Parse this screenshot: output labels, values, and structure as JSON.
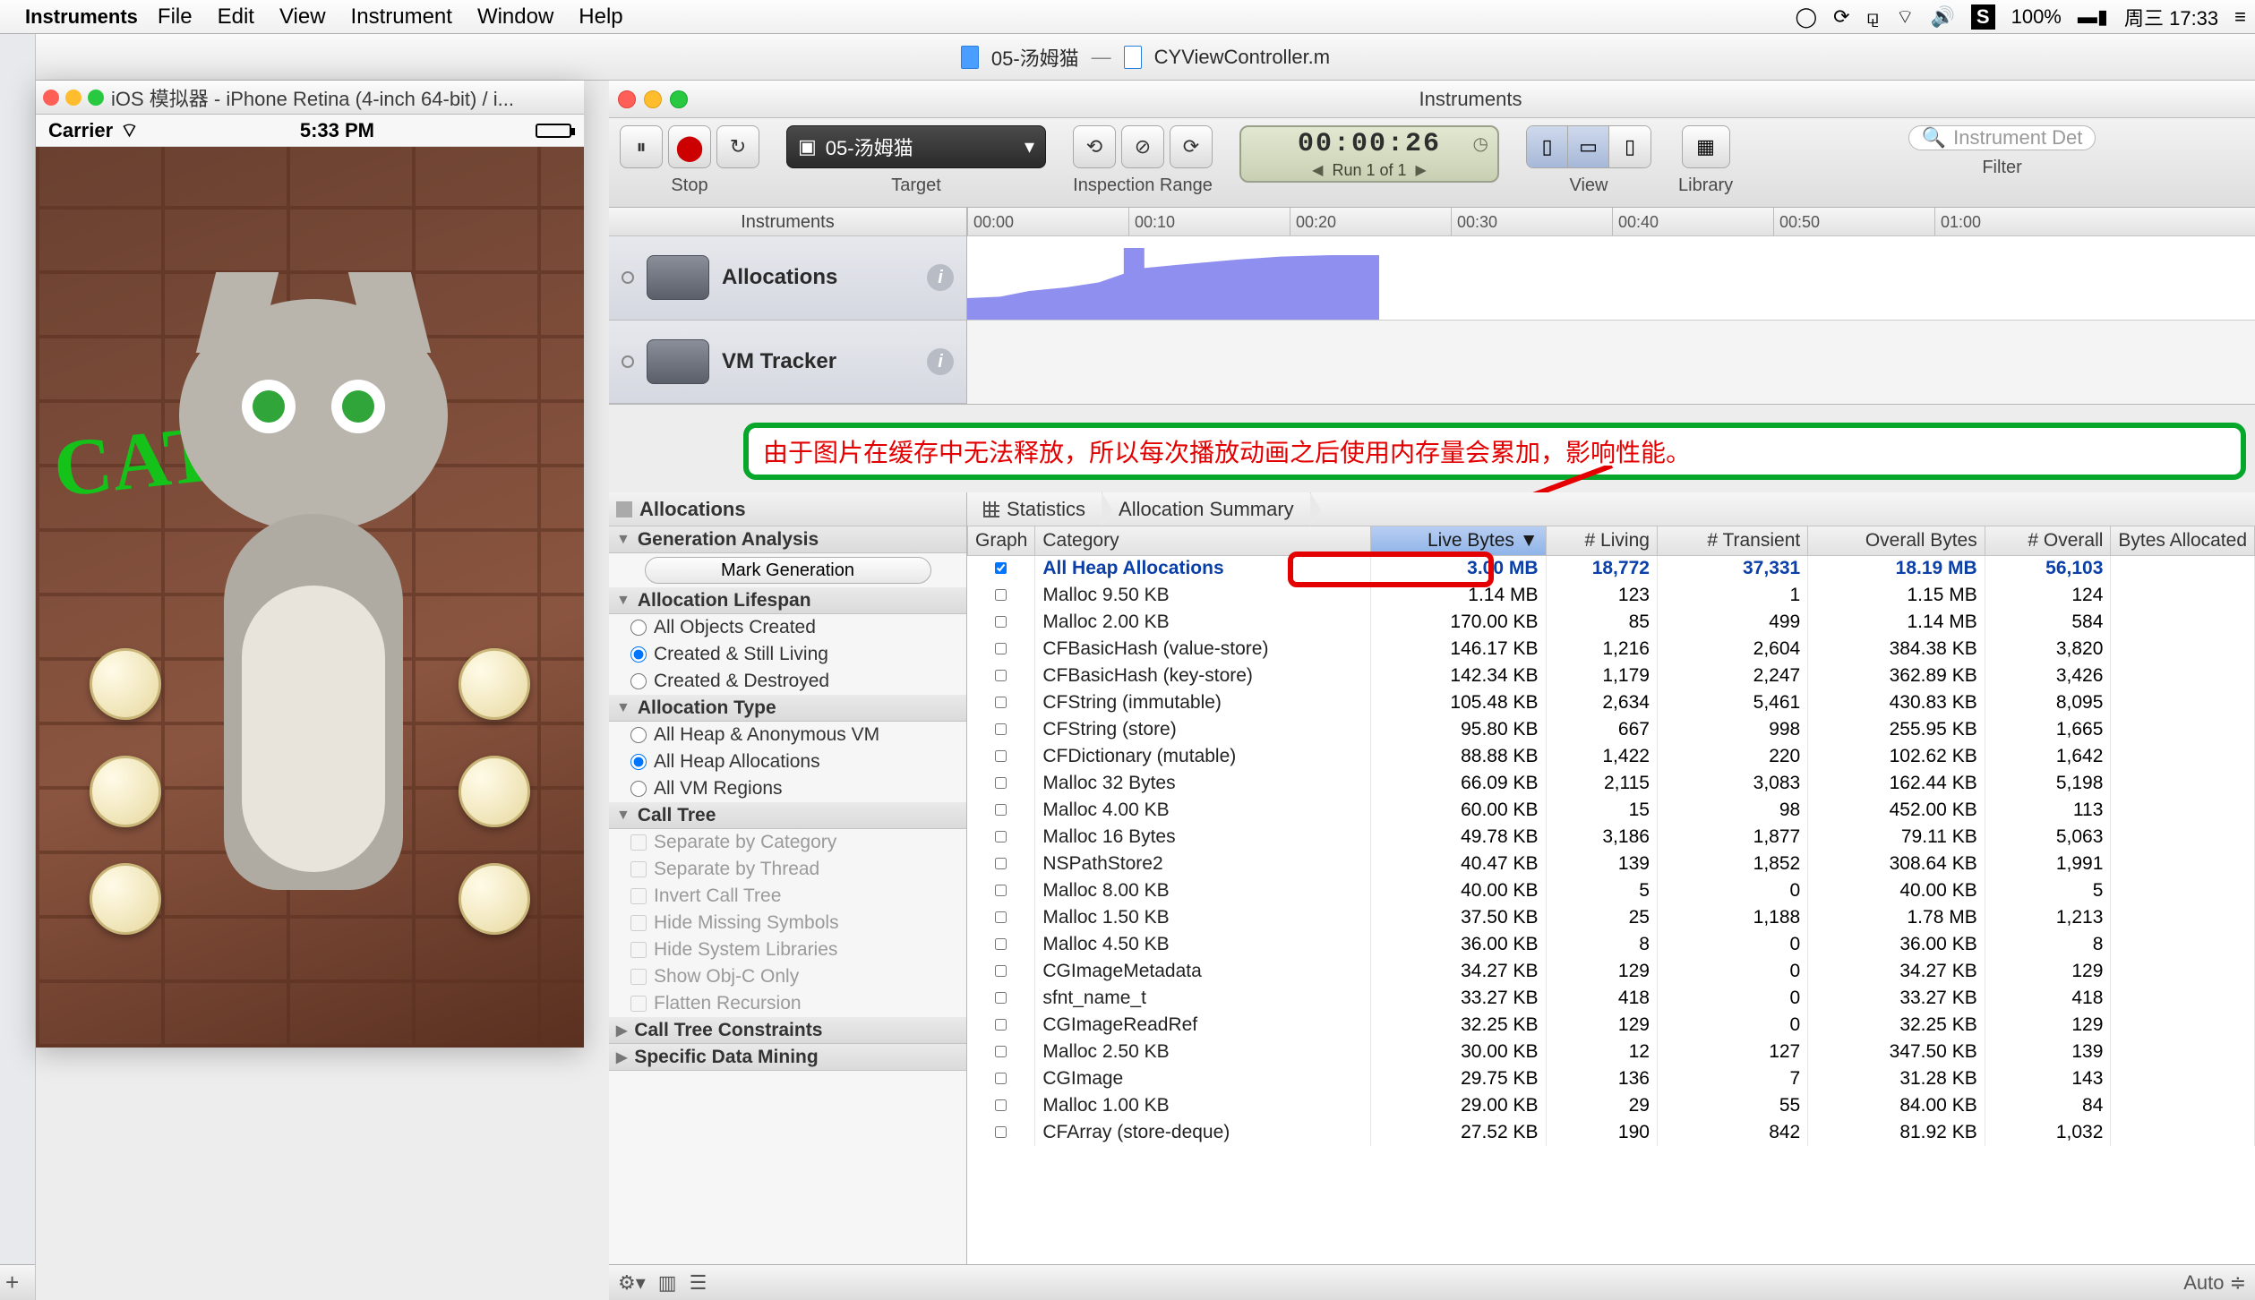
{
  "menubar": {
    "app": "Instruments",
    "items": [
      "File",
      "Edit",
      "View",
      "Instrument",
      "Window",
      "Help"
    ],
    "battery": "100%",
    "clock": "周三 17:33",
    "s_icon": "S"
  },
  "xcode": {
    "doc1": "05-汤姆猫",
    "sep": "—",
    "doc2": "CYViewController.m"
  },
  "simulator": {
    "title": "iOS 模拟器 - iPhone Retina (4-inch 64-bit) / i...",
    "carrier": "Carrier",
    "time": "5:33 PM",
    "graffiti": "CAT"
  },
  "instruments": {
    "window_title": "Instruments",
    "stop_label": "Stop",
    "target_label": "Target",
    "target_value": "05-汤姆猫",
    "inspection_label": "Inspection Range",
    "timer": "00:00:26",
    "run_text": "Run 1 of 1",
    "view_label": "View",
    "library_label": "Library",
    "filter_label": "Filter",
    "search_placeholder": "Instrument Det",
    "tracks_header": "Instruments",
    "track1": "Allocations",
    "track2": "VM Tracker",
    "ruler": [
      "00:00",
      "00:10",
      "00:20",
      "00:30",
      "00:40",
      "00:50",
      "01:00"
    ]
  },
  "annotation": "由于图片在缓存中无法释放，所以每次播放动画之后使用内存量会累加，影响性能。",
  "sidebar": {
    "header": "Allocations",
    "sections": {
      "gen": "Generation Analysis",
      "mark": "Mark Generation",
      "lifespan": "Allocation Lifespan",
      "ls_items": [
        "All Objects Created",
        "Created & Still Living",
        "Created & Destroyed"
      ],
      "alloc_type": "Allocation Type",
      "at_items": [
        "All Heap & Anonymous VM",
        "All Heap Allocations",
        "All VM Regions"
      ],
      "call_tree": "Call Tree",
      "ct_items": [
        "Separate by Category",
        "Separate by Thread",
        "Invert Call Tree",
        "Hide Missing Symbols",
        "Hide System Libraries",
        "Show Obj-C Only",
        "Flatten Recursion"
      ],
      "constraints": "Call Tree Constraints",
      "mining": "Specific Data Mining"
    }
  },
  "breadcrumb": {
    "stats": "Statistics",
    "summary": "Allocation Summary"
  },
  "table": {
    "headers": {
      "graph": "Graph",
      "category": "Category",
      "live_bytes": "Live Bytes",
      "living": "# Living",
      "transient": "# Transient",
      "overall_bytes": "Overall Bytes",
      "overall": "# Overall",
      "bytes_alloc": "Bytes Allocated"
    },
    "rows": [
      {
        "cat": "All Heap Allocations",
        "lb": "3.00 MB",
        "liv": "18,772",
        "tr": "37,331",
        "ob": "18.19 MB",
        "ov": "56,103",
        "sel": true,
        "chk": true
      },
      {
        "cat": "Malloc 9.50 KB",
        "lb": "1.14 MB",
        "liv": "123",
        "tr": "1",
        "ob": "1.15 MB",
        "ov": "124"
      },
      {
        "cat": "Malloc 2.00 KB",
        "lb": "170.00 KB",
        "liv": "85",
        "tr": "499",
        "ob": "1.14 MB",
        "ov": "584"
      },
      {
        "cat": "CFBasicHash (value-store)",
        "lb": "146.17 KB",
        "liv": "1,216",
        "tr": "2,604",
        "ob": "384.38 KB",
        "ov": "3,820"
      },
      {
        "cat": "CFBasicHash (key-store)",
        "lb": "142.34 KB",
        "liv": "1,179",
        "tr": "2,247",
        "ob": "362.89 KB",
        "ov": "3,426"
      },
      {
        "cat": "CFString (immutable)",
        "lb": "105.48 KB",
        "liv": "2,634",
        "tr": "5,461",
        "ob": "430.83 KB",
        "ov": "8,095"
      },
      {
        "cat": "CFString (store)",
        "lb": "95.80 KB",
        "liv": "667",
        "tr": "998",
        "ob": "255.95 KB",
        "ov": "1,665"
      },
      {
        "cat": "CFDictionary (mutable)",
        "lb": "88.88 KB",
        "liv": "1,422",
        "tr": "220",
        "ob": "102.62 KB",
        "ov": "1,642"
      },
      {
        "cat": "Malloc 32 Bytes",
        "lb": "66.09 KB",
        "liv": "2,115",
        "tr": "3,083",
        "ob": "162.44 KB",
        "ov": "5,198"
      },
      {
        "cat": "Malloc 4.00 KB",
        "lb": "60.00 KB",
        "liv": "15",
        "tr": "98",
        "ob": "452.00 KB",
        "ov": "113"
      },
      {
        "cat": "Malloc 16 Bytes",
        "lb": "49.78 KB",
        "liv": "3,186",
        "tr": "1,877",
        "ob": "79.11 KB",
        "ov": "5,063"
      },
      {
        "cat": "NSPathStore2",
        "lb": "40.47 KB",
        "liv": "139",
        "tr": "1,852",
        "ob": "308.64 KB",
        "ov": "1,991"
      },
      {
        "cat": "Malloc 8.00 KB",
        "lb": "40.00 KB",
        "liv": "5",
        "tr": "0",
        "ob": "40.00 KB",
        "ov": "5"
      },
      {
        "cat": "Malloc 1.50 KB",
        "lb": "37.50 KB",
        "liv": "25",
        "tr": "1,188",
        "ob": "1.78 MB",
        "ov": "1,213"
      },
      {
        "cat": "Malloc 4.50 KB",
        "lb": "36.00 KB",
        "liv": "8",
        "tr": "0",
        "ob": "36.00 KB",
        "ov": "8"
      },
      {
        "cat": "CGImageMetadata",
        "lb": "34.27 KB",
        "liv": "129",
        "tr": "0",
        "ob": "34.27 KB",
        "ov": "129"
      },
      {
        "cat": "sfnt_name_t",
        "lb": "33.27 KB",
        "liv": "418",
        "tr": "0",
        "ob": "33.27 KB",
        "ov": "418"
      },
      {
        "cat": "CGImageReadRef",
        "lb": "32.25 KB",
        "liv": "129",
        "tr": "0",
        "ob": "32.25 KB",
        "ov": "129"
      },
      {
        "cat": "Malloc 2.50 KB",
        "lb": "30.00 KB",
        "liv": "12",
        "tr": "127",
        "ob": "347.50 KB",
        "ov": "139"
      },
      {
        "cat": "CGImage",
        "lb": "29.75 KB",
        "liv": "136",
        "tr": "7",
        "ob": "31.28 KB",
        "ov": "143"
      },
      {
        "cat": "Malloc 1.00 KB",
        "lb": "29.00 KB",
        "liv": "29",
        "tr": "55",
        "ob": "84.00 KB",
        "ov": "84"
      },
      {
        "cat": "CFArray (store-deque)",
        "lb": "27.52 KB",
        "liv": "190",
        "tr": "842",
        "ob": "81.92 KB",
        "ov": "1,032"
      }
    ]
  },
  "bottom": {
    "auto": "Auto"
  }
}
